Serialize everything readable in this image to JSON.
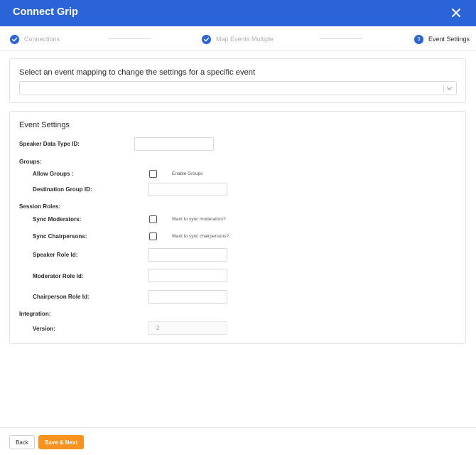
{
  "header": {
    "title": "Connect Grip",
    "close_icon": "close-icon"
  },
  "stepper": {
    "steps": [
      {
        "label": "Connections",
        "state": "done",
        "icon": "check-circle-icon"
      },
      {
        "label": "Map Events Multiple",
        "state": "done",
        "icon": "check-circle-icon"
      },
      {
        "label": "Event Settings",
        "state": "active",
        "number": "3"
      }
    ]
  },
  "mapping": {
    "title": "Select an event mapping to change the settings for a specific event",
    "selected_value": "",
    "icon": "chevron-down-icon"
  },
  "settings": {
    "title": "Event Settings",
    "speaker_data_type_id": {
      "label": "Speaker Data Type ID:",
      "value": ""
    },
    "groups": {
      "heading": "Groups:",
      "allow_groups": {
        "label": "Allow Groups :",
        "hint": "Enable Groups",
        "checked": false
      },
      "destination_group_id": {
        "label": "Destination Group ID:",
        "value": ""
      }
    },
    "session_roles": {
      "heading": "Session Roles:",
      "sync_moderators": {
        "label": "Sync Moderators:",
        "hint": "Want to sync moderators?",
        "checked": false
      },
      "sync_chairpersons": {
        "label": "Sync Chairpersons:",
        "hint": "Want to sync chairpersons?",
        "checked": false
      },
      "speaker_role_id": {
        "label": "Speaker Role Id:",
        "value": ""
      },
      "moderator_role_id": {
        "label": "Moderator Role Id:",
        "value": ""
      },
      "chairperson_role_id": {
        "label": "Chairperson Role Id:",
        "value": ""
      }
    },
    "integration": {
      "heading": "Integration:",
      "version": {
        "label": "Version:",
        "value": "2"
      }
    }
  },
  "footer": {
    "back_label": "Back",
    "next_label": "Save & Next"
  },
  "colors": {
    "primary": "#2b63d9",
    "accent": "#f7931e"
  }
}
